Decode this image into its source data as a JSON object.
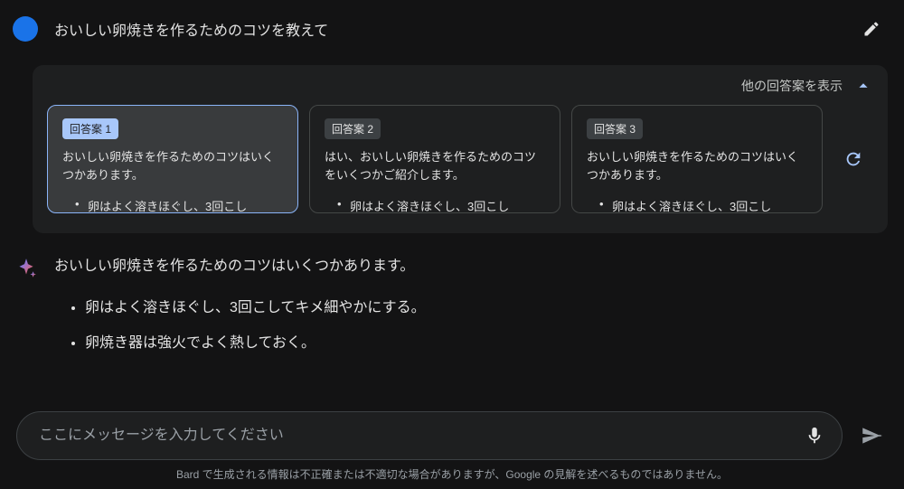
{
  "prompt": {
    "text": "おいしい卵焼きを作るためのコツを教えて"
  },
  "drafts": {
    "header_label": "他の回答案を表示",
    "cards": [
      {
        "badge": "回答案 1",
        "preview": "おいしい卵焼きを作るためのコツはいくつかあります。",
        "bullet": "卵はよく溶きほぐし、3回こし"
      },
      {
        "badge": "回答案 2",
        "preview": "はい、おいしい卵焼きを作るためのコツをいくつかご紹介します。",
        "bullet": "卵はよく溶きほぐし、3回こし"
      },
      {
        "badge": "回答案 3",
        "preview": "おいしい卵焼きを作るためのコツはいくつかあります。",
        "bullet": "卵はよく溶きほぐし、3回こし"
      }
    ]
  },
  "response": {
    "intro": "おいしい卵焼きを作るためのコツはいくつかあります。",
    "bullets": [
      "卵はよく溶きほぐし、3回こしてキメ細やかにする。",
      "卵焼き器は強火でよく熱しておく。"
    ]
  },
  "input": {
    "placeholder": "ここにメッセージを入力してください"
  },
  "footer": {
    "text": "Bard で生成される情報は不正確または不適切な場合がありますが、Google の見解を述べるものではありません。"
  }
}
